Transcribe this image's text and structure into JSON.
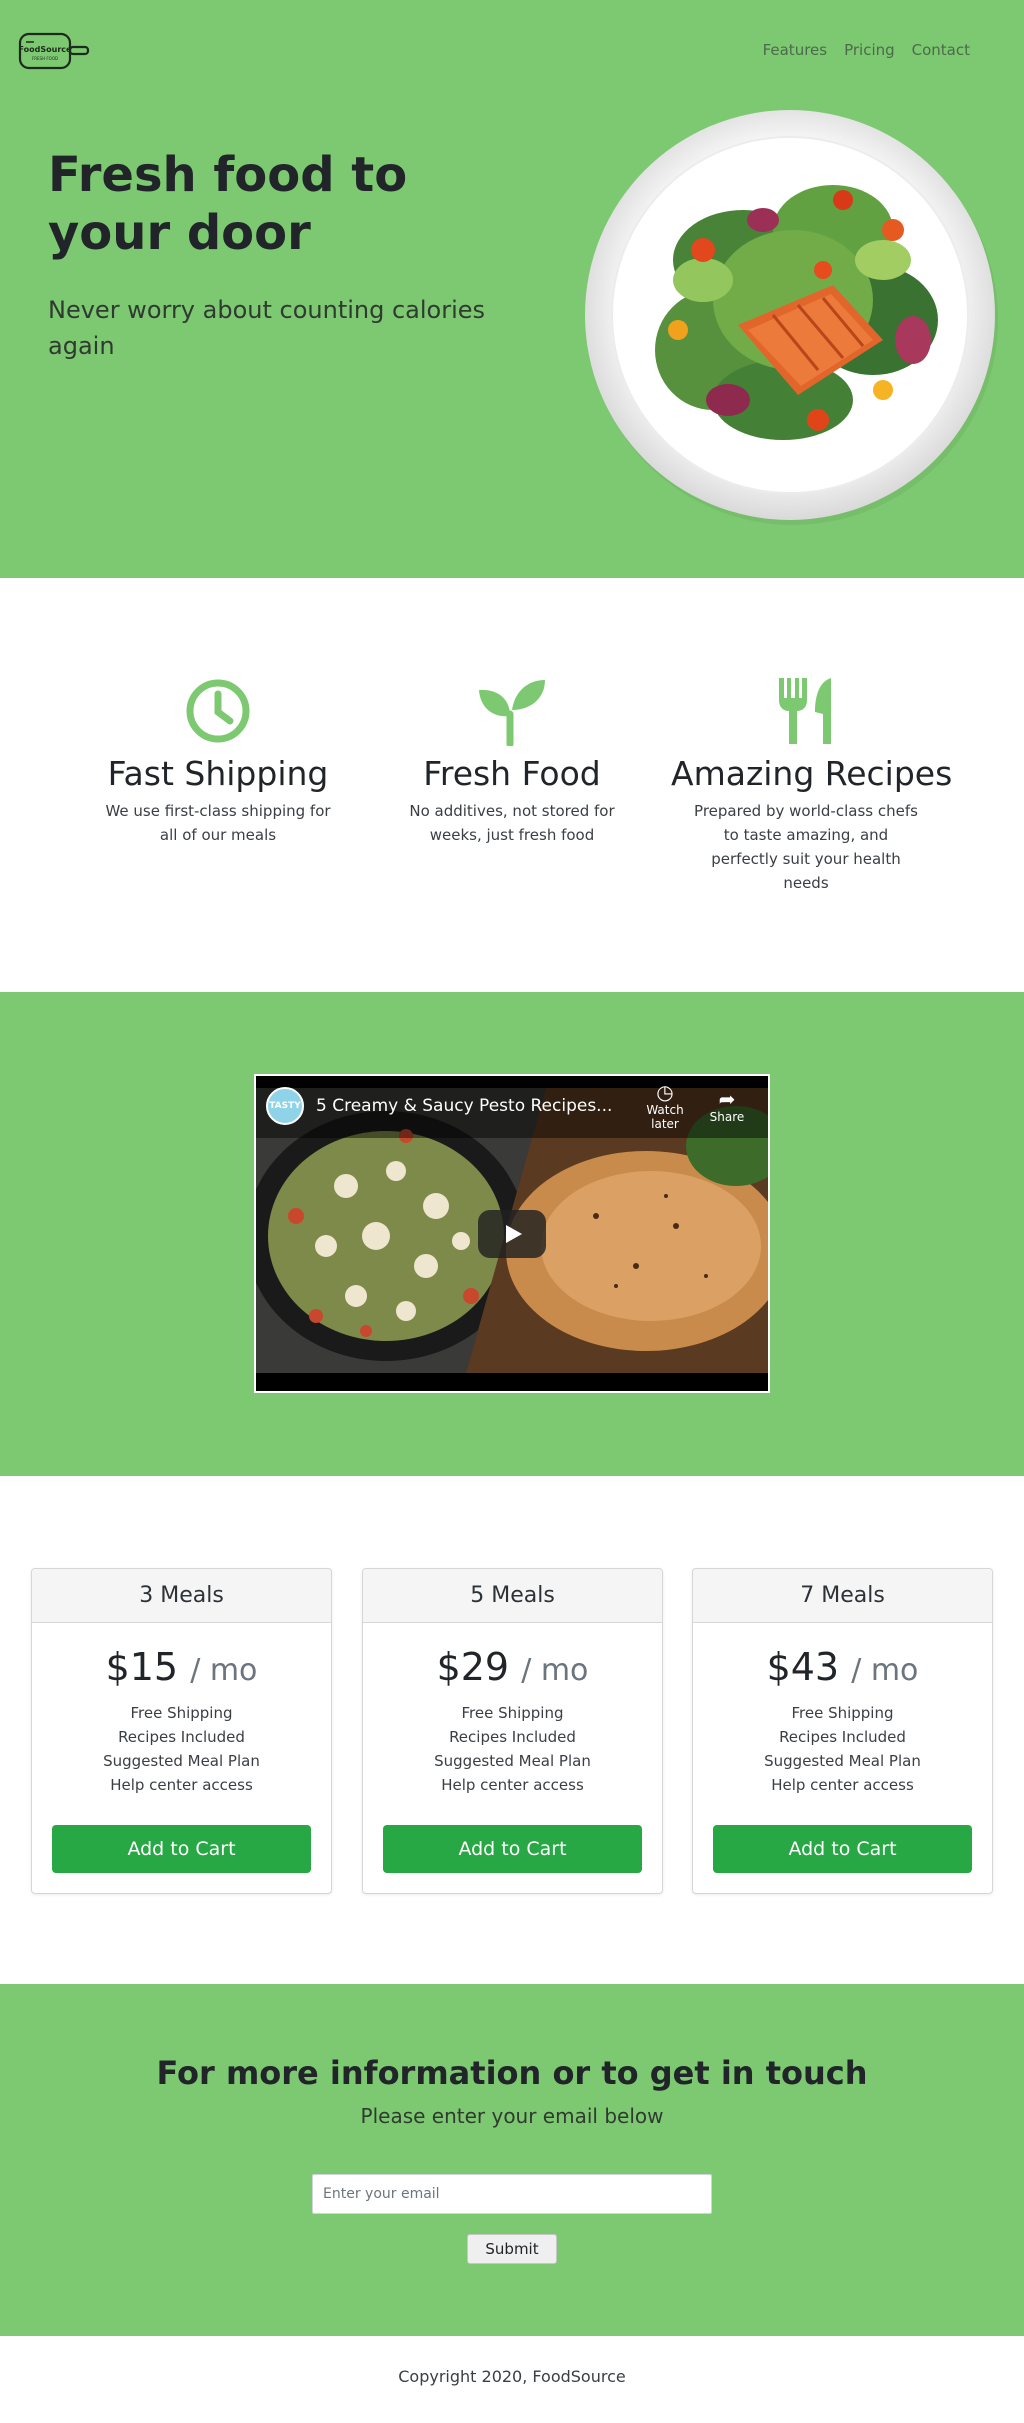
{
  "brand": {
    "logo_text": "FoodSource",
    "logo_tagline": "FRESH FOOD"
  },
  "nav": {
    "items": [
      {
        "label": "Features"
      },
      {
        "label": "Pricing"
      },
      {
        "label": "Contact"
      }
    ]
  },
  "hero": {
    "title": "Fresh food to your door",
    "subtitle": "Never worry about counting calories again"
  },
  "features": [
    {
      "title": "Fast Shipping",
      "text": "We use first-class shipping for all of our meals",
      "icon": "clock-icon"
    },
    {
      "title": "Fresh Food",
      "text": "No additives, not stored for weeks, just fresh food",
      "icon": "sprout-icon"
    },
    {
      "title": "Amazing Recipes",
      "text": "Prepared by world-class chefs to taste amazing, and perfectly suit your health needs",
      "icon": "utensils-icon"
    }
  ],
  "video": {
    "title": "5 Creamy & Saucy Pesto Recipes...",
    "channel_badge": "TASTY",
    "watch_later_label": "Watch later",
    "share_label": "Share"
  },
  "pricing": [
    {
      "name": "3 Meals",
      "price": "$15",
      "period": "/ mo",
      "perks": [
        "Free Shipping",
        "Recipes Included",
        "Suggested Meal Plan",
        "Help center access"
      ],
      "button": "Add to Cart"
    },
    {
      "name": "5 Meals",
      "price": "$29",
      "period": "/ mo",
      "perks": [
        "Free Shipping",
        "Recipes Included",
        "Suggested Meal Plan",
        "Help center access"
      ],
      "button": "Add to Cart"
    },
    {
      "name": "7 Meals",
      "price": "$43",
      "period": "/ mo",
      "perks": [
        "Free Shipping",
        "Recipes Included",
        "Suggested Meal Plan",
        "Help center access"
      ],
      "button": "Add to Cart"
    }
  ],
  "contact": {
    "title": "For more information or to get in touch",
    "subtitle": "Please enter your email below",
    "email_placeholder": "Enter your email",
    "submit_label": "Submit"
  },
  "footer": {
    "copyright": "Copyright 2020, FoodSource"
  },
  "colors": {
    "brand_green": "#7dc971",
    "button_green": "#28a745",
    "icon_green": "#7dc971"
  }
}
